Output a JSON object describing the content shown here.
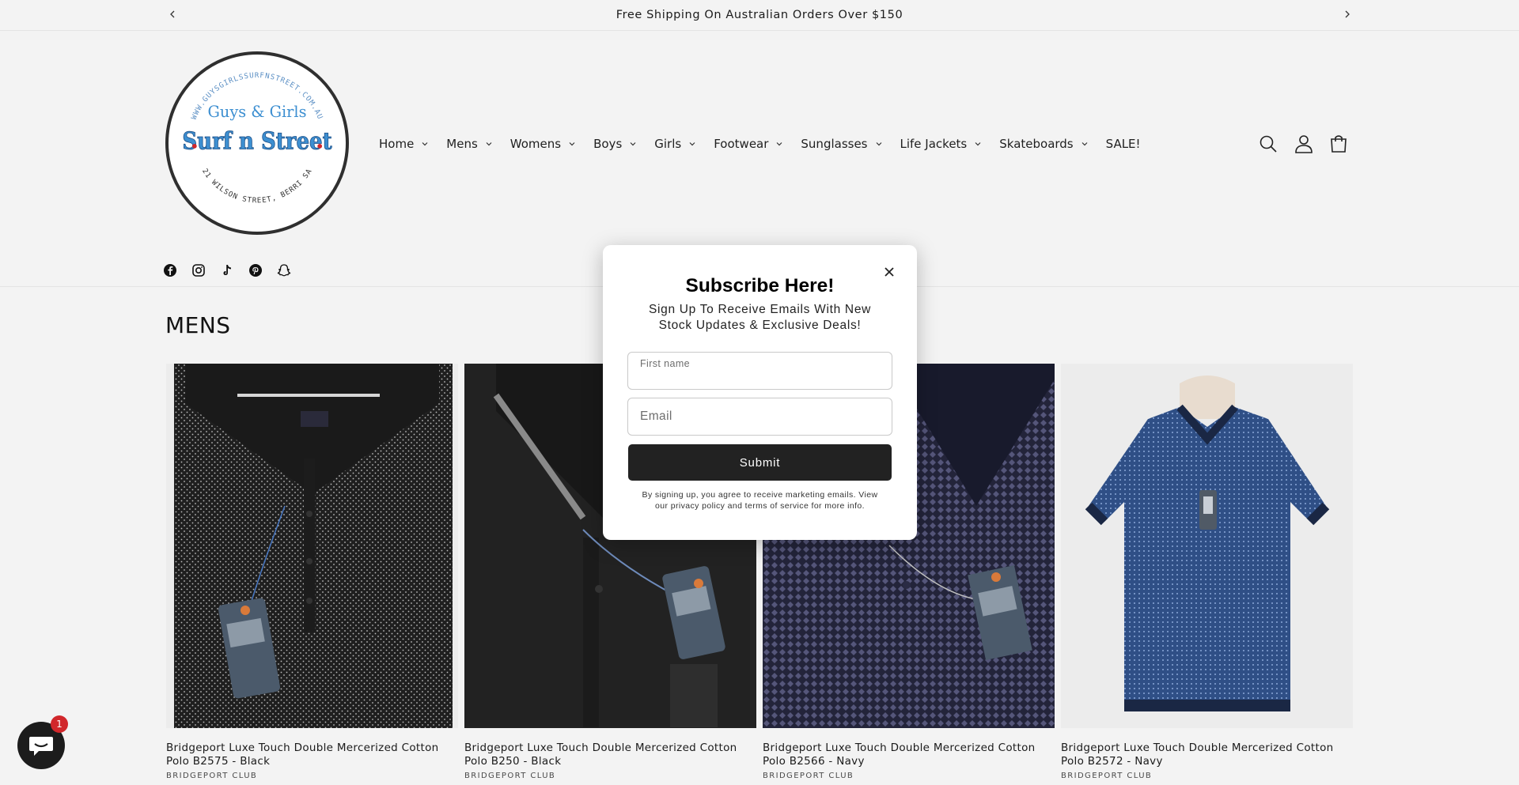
{
  "announcement": {
    "text": "Free Shipping On Australian Orders Over $150"
  },
  "logo": {
    "line1": "Guys & Girls",
    "line2": "Surf n Street",
    "ring_top": "WWW.GUYSGIRLSSURFNSTREET.COM.AU",
    "ring_bottom": "21 WILSON STREET, BERRI SA"
  },
  "nav": {
    "items": [
      {
        "label": "Home",
        "has_dropdown": true
      },
      {
        "label": "Mens",
        "has_dropdown": true
      },
      {
        "label": "Womens",
        "has_dropdown": true
      },
      {
        "label": "Boys",
        "has_dropdown": true
      },
      {
        "label": "Girls",
        "has_dropdown": true
      },
      {
        "label": "Footwear",
        "has_dropdown": true
      },
      {
        "label": "Sunglasses",
        "has_dropdown": true
      },
      {
        "label": "Life Jackets",
        "has_dropdown": true
      },
      {
        "label": "Skateboards",
        "has_dropdown": true
      },
      {
        "label": "SALE!",
        "has_dropdown": false
      }
    ]
  },
  "header_icons": [
    "search-icon",
    "account-icon",
    "cart-icon"
  ],
  "social_icons": [
    "facebook-icon",
    "instagram-icon",
    "tiktok-icon",
    "pinterest-icon",
    "snapchat-icon"
  ],
  "collection": {
    "title": "MENS",
    "products": [
      {
        "title": "Bridgeport Luxe Touch Double Mercerized Cotton Polo B2575 - Black",
        "vendor": "BRIDGEPORT CLUB"
      },
      {
        "title": "Bridgeport Luxe Touch Double Mercerized Cotton Polo B250 - Black",
        "vendor": "BRIDGEPORT CLUB"
      },
      {
        "title": "Bridgeport Luxe Touch Double Mercerized Cotton Polo B2566 - Navy",
        "vendor": "BRIDGEPORT CLUB"
      },
      {
        "title": "Bridgeport Luxe Touch Double Mercerized Cotton Polo B2572 - Navy",
        "vendor": "BRIDGEPORT CLUB"
      }
    ]
  },
  "popup": {
    "heading": "Subscribe Here!",
    "subheading": "Sign Up To Receive Emails With New Stock Updates & Exclusive Deals!",
    "first_name_label": "First name",
    "email_placeholder": "Email",
    "submit_label": "Submit",
    "legal": "By signing up, you agree to receive marketing emails. View our privacy policy and terms of service for more info."
  },
  "chat": {
    "badge_count": "1"
  },
  "colors": {
    "page_bg": "#f3f3f3",
    "button_bg": "#222222",
    "badge": "#d1272b",
    "logo_blue": "#3d8fd1"
  }
}
